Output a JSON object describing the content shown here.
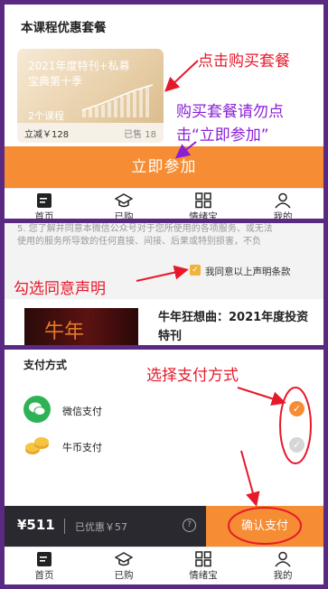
{
  "colors": {
    "accent": "#f68c33",
    "annotation_red": "#e6192b",
    "annotation_purple": "#8a1fd6",
    "frame": "#5a2a82"
  },
  "panel1": {
    "section_title": "本课程优惠套餐",
    "card": {
      "line1": "2021年度特刊+私募",
      "line2": "宝典第十季",
      "courses": "2个课程",
      "price": "立减￥128",
      "sold": "已售 18"
    },
    "cta_label": "立即参加",
    "annotation_buy": "点击购买套餐",
    "annotation_warn_1": "购买套餐请勿点",
    "annotation_warn_2": "击“立即参加”"
  },
  "tabs": [
    {
      "label": "首页",
      "icon": "home-icon"
    },
    {
      "label": "已购",
      "icon": "graduation-cap-icon"
    },
    {
      "label": "情绪宝",
      "icon": "grid-icon"
    },
    {
      "label": "我的",
      "icon": "user-icon"
    }
  ],
  "panel2": {
    "legal_line1": "5. 您了解并同意本微信公众号对于您所使用的各项服务、或无法",
    "legal_line2": "使用的服务所导致的任何直接、间接、后果或特别损害，不负",
    "agree_label": "我同意以上声明条款",
    "annotation_check": "勾选同意声明",
    "product_title": "牛年狂想曲：2021年度投资特刊",
    "product_image_text": "牛年"
  },
  "panel3": {
    "section_title": "支付方式",
    "annotation_pay": "选择支付方式",
    "methods": [
      {
        "label": "微信支付",
        "icon": "wechat-icon",
        "selected": true
      },
      {
        "label": "牛币支付",
        "icon": "coin-icon",
        "selected": false
      }
    ],
    "total": "¥511",
    "discount": "已优惠￥57",
    "confirm_label": "确认支付"
  }
}
